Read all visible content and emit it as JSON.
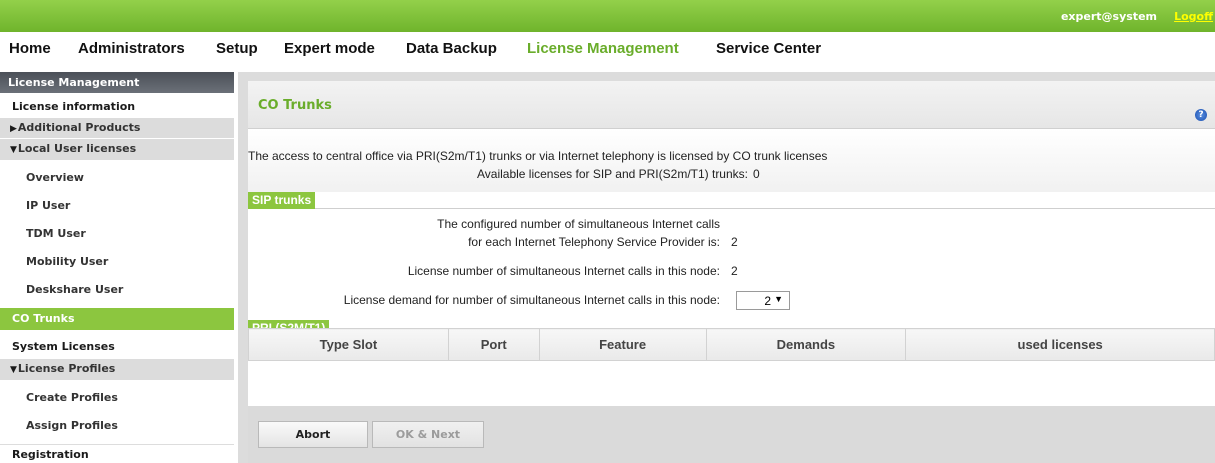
{
  "topbar": {
    "user": "expert@system",
    "logoff": "Logoff"
  },
  "nav": {
    "items": [
      "Home",
      "Administrators",
      "Setup",
      "Expert mode",
      "Data Backup",
      "License Management",
      "Service Center"
    ],
    "active": "License Management"
  },
  "sidebar": {
    "header": "License Management",
    "items": [
      "License information",
      "Additional Products",
      "Local User licenses",
      "Overview",
      "IP User",
      "TDM User",
      "Mobility User",
      "Deskshare User",
      "CO Trunks",
      "System Licenses",
      "License Profiles",
      "Create Profiles",
      "Assign Profiles",
      "Registration"
    ]
  },
  "panel": {
    "title": "CO Trunks",
    "help_icon": "?",
    "intro": "The access to central office via PRI(S2m/T1) trunks or via Internet telephony is licensed by CO trunk licenses",
    "available_label": "Available licenses for SIP and PRI(S2m/T1) trunks:",
    "available_value": "0",
    "sip_header": "SIP trunks",
    "sip_line1": "The configured number of simultaneous Internet calls",
    "sip_line2": "for each Internet Telephony Service Provider is:",
    "sip_configured_value": "2",
    "license_number_label": "License number of simultaneous Internet calls in this node:",
    "license_number_value": "2",
    "license_demand_label": "License demand for number of simultaneous Internet calls in this node:",
    "license_demand_value": "2",
    "pri_header": "PRI (S2M/T1)",
    "table_columns": [
      "Type Slot",
      "Port",
      "Feature",
      "Demands",
      "used licenses"
    ]
  },
  "buttons": {
    "abort": "Abort",
    "ok_next": "OK & Next"
  },
  "colors": {
    "accent_green": "#8cc63f",
    "active_nav": "#6aad2b",
    "logoff": "#ffff00"
  }
}
